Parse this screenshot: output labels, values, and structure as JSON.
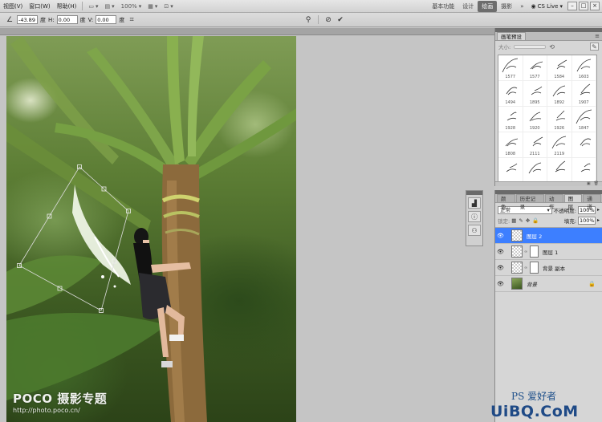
{
  "menubar": {
    "items": [
      "视图(V)",
      "窗口(W)",
      "帮助(H)"
    ],
    "zoom": "100%",
    "workspaces": [
      "基本功能",
      "设计",
      "绘画",
      "摄影"
    ],
    "active_workspace": "绘画",
    "cslive": "CS Live"
  },
  "options": {
    "angle_value": "-43.89",
    "angle_unit": "度",
    "h_label": "H:",
    "h_value": "0.00",
    "h_unit": "度",
    "v_label": "V:",
    "v_value": "0.00",
    "v_unit": "度"
  },
  "brush_panel": {
    "title": "画笔预设",
    "size_label": "大小:",
    "presets": [
      "1577",
      "1577",
      "1584",
      "1603",
      "1494",
      "1895",
      "1892",
      "1907",
      "1928",
      "1920",
      "1926",
      "1847",
      "1808",
      "2111",
      "2119",
      "",
      "",
      "",
      "",
      ""
    ]
  },
  "layers_panel": {
    "tabs": [
      "颜色",
      "历史记录",
      "动作",
      "图层",
      "通道"
    ],
    "active_tab": "图层",
    "blend_mode": "正常",
    "opacity_label": "不透明度:",
    "opacity_value": "100%",
    "lock_label": "锁定:",
    "fill_label": "填充:",
    "fill_value": "100%",
    "layers": [
      {
        "name": "图层 2",
        "selected": true,
        "type": "transparent"
      },
      {
        "name": "图层 1",
        "selected": false,
        "type": "transparent-mask"
      },
      {
        "name": "背景 副本",
        "selected": false,
        "type": "transparent-mask"
      },
      {
        "name": "背景",
        "selected": false,
        "type": "photo",
        "locked": true
      }
    ]
  },
  "canvas": {
    "watermark_main": "POCO 摄影专题",
    "watermark_url": "http://photo.poco.cn/"
  },
  "logo": {
    "top_text": "PS 爱好者",
    "main_text": "UiBQ.CoM"
  },
  "colors": {
    "selected_layer": "#3d7fff",
    "active_workspace_bg": "#6d6d6d",
    "logo_blue": "#1f4a86"
  }
}
